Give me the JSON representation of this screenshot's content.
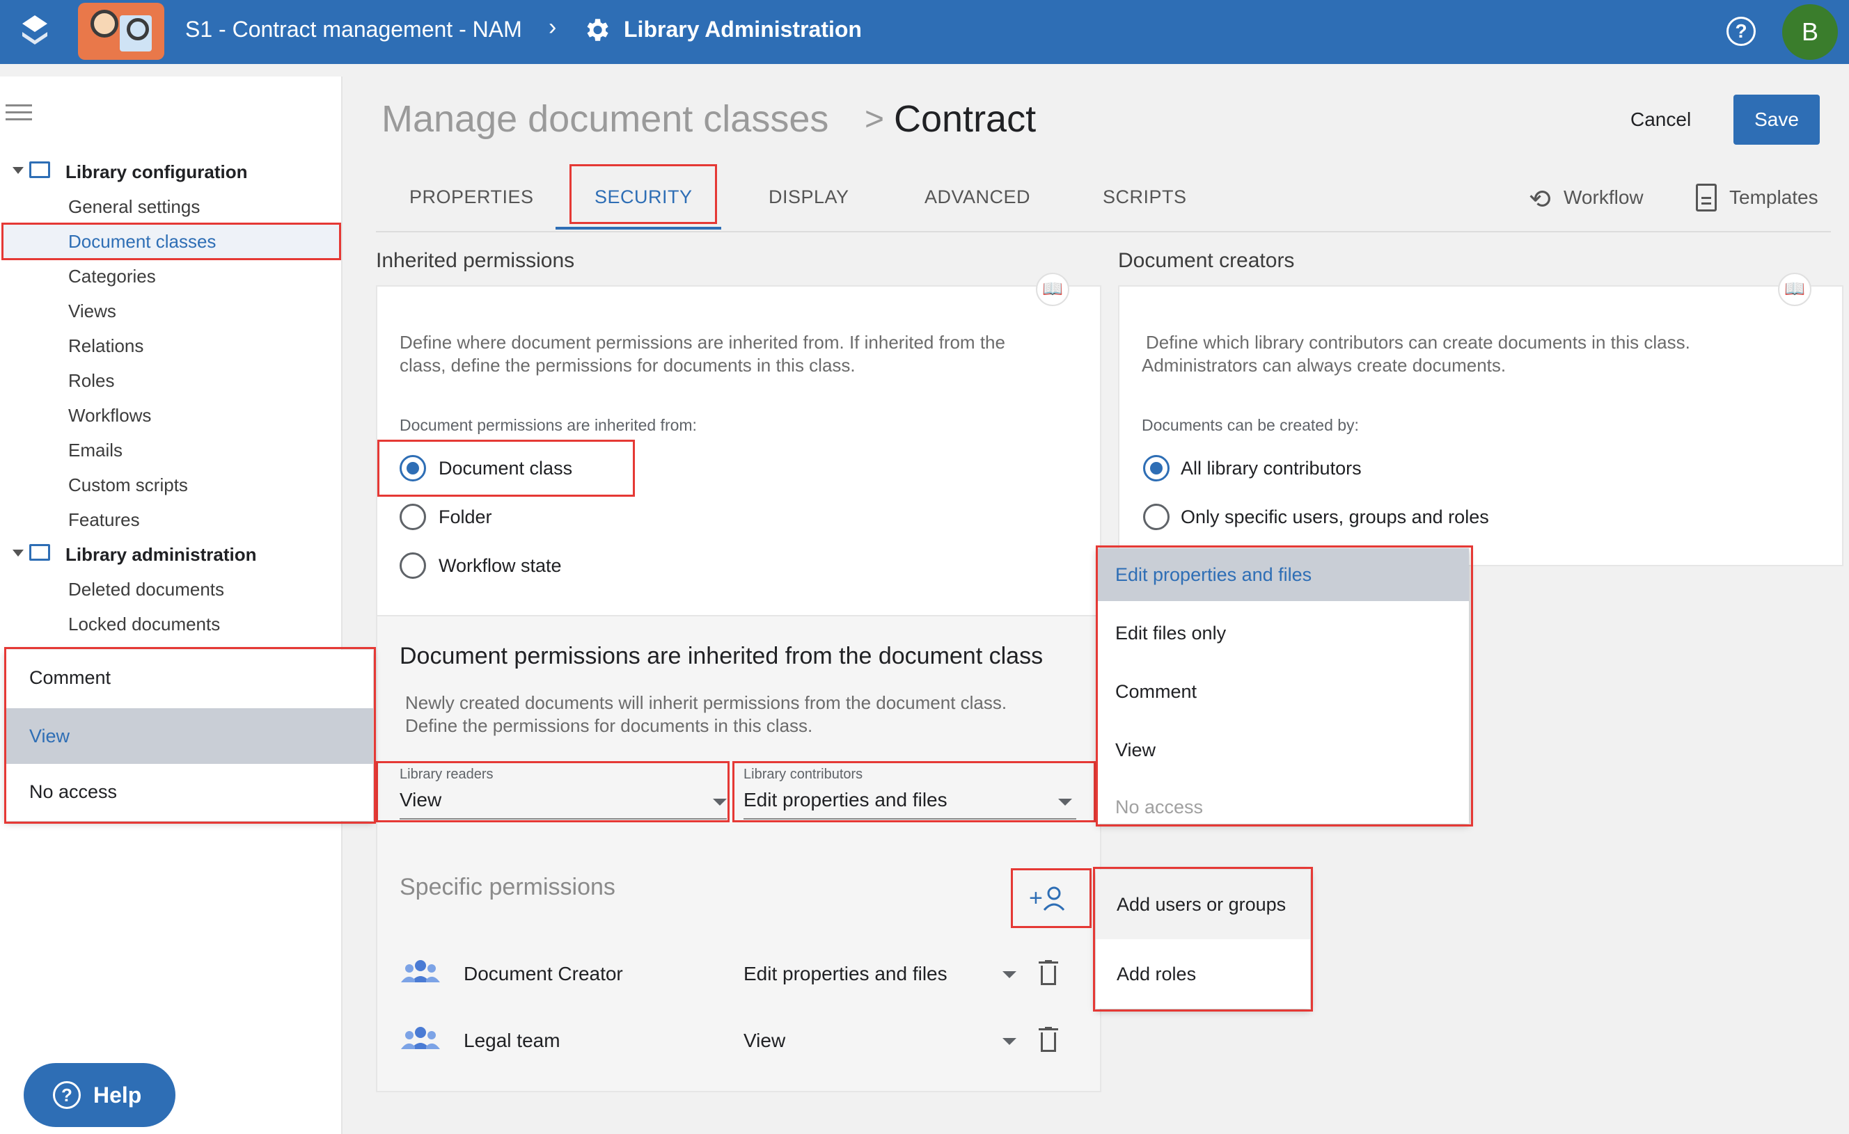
{
  "app": {
    "title": "S1 - Contract management - NAM",
    "section": "Library Administration",
    "avatar_letter": "B",
    "icons": {
      "logo": "stack-logo-icon",
      "help": "help-circle-icon",
      "settings": "gear-icon"
    }
  },
  "sidebar": {
    "groups": [
      {
        "label": "Library configuration",
        "items": [
          "General settings",
          "Document classes",
          "Categories",
          "Views",
          "Relations",
          "Roles",
          "Workflows",
          "Emails",
          "Custom scripts",
          "Features"
        ]
      },
      {
        "label": "Library administration",
        "items": [
          "Deleted documents",
          "Locked documents"
        ]
      }
    ],
    "selected": "Document classes",
    "help_button": "Help"
  },
  "header": {
    "breadcrumb_parent": "Manage document classes",
    "separator": ">",
    "title": "Contract",
    "cancel": "Cancel",
    "save": "Save"
  },
  "tabs": [
    "PROPERTIES",
    "SECURITY",
    "DISPLAY",
    "ADVANCED",
    "SCRIPTS"
  ],
  "active_tab": "SECURITY",
  "tab_actions": {
    "workflow": "Workflow",
    "templates": "Templates"
  },
  "inherited": {
    "heading": "Inherited permissions",
    "description": [
      "Define where document permissions are inherited from. If inherited from the",
      "class, define the permissions for documents in this class."
    ],
    "question": "Document permissions are inherited from:",
    "options": [
      "Document class",
      "Folder",
      "Workflow state"
    ],
    "selected": "Document class"
  },
  "class_perms": {
    "heading": "Document permissions are inherited from the document class",
    "description": [
      "Newly created documents will inherit permissions from the document class.",
      "Define the permissions for documents in this class."
    ],
    "readers_label": "Library readers",
    "readers_value": "View",
    "contributors_label": "Library contributors",
    "contributors_value": "Edit properties and files"
  },
  "specific": {
    "heading": "Specific permissions",
    "rows": [
      {
        "name": "Document Creator",
        "permission": "Edit properties and files"
      },
      {
        "name": "Legal team",
        "permission": "View"
      }
    ]
  },
  "creators": {
    "heading": "Document creators",
    "description": [
      "Define which library contributors can create documents in this class.",
      "Administrators can always create documents."
    ],
    "question": "Documents can be created by:",
    "options": [
      "All library contributors",
      "Only specific users, groups and roles"
    ],
    "selected": "All library contributors"
  },
  "readers_menu": {
    "items": [
      "Comment",
      "View",
      "No access"
    ],
    "selected": "View"
  },
  "contributors_menu": {
    "items": [
      "Edit properties and files",
      "Edit files only",
      "Comment",
      "View",
      "No access"
    ],
    "selected": "Edit properties and files",
    "disabled": "No access"
  },
  "add_menu": {
    "items": [
      "Add users or groups",
      "Add roles"
    ]
  },
  "colors": {
    "brand": "#2e6eb5",
    "highlight": "#e53935",
    "avatar": "#3a7d2c"
  }
}
